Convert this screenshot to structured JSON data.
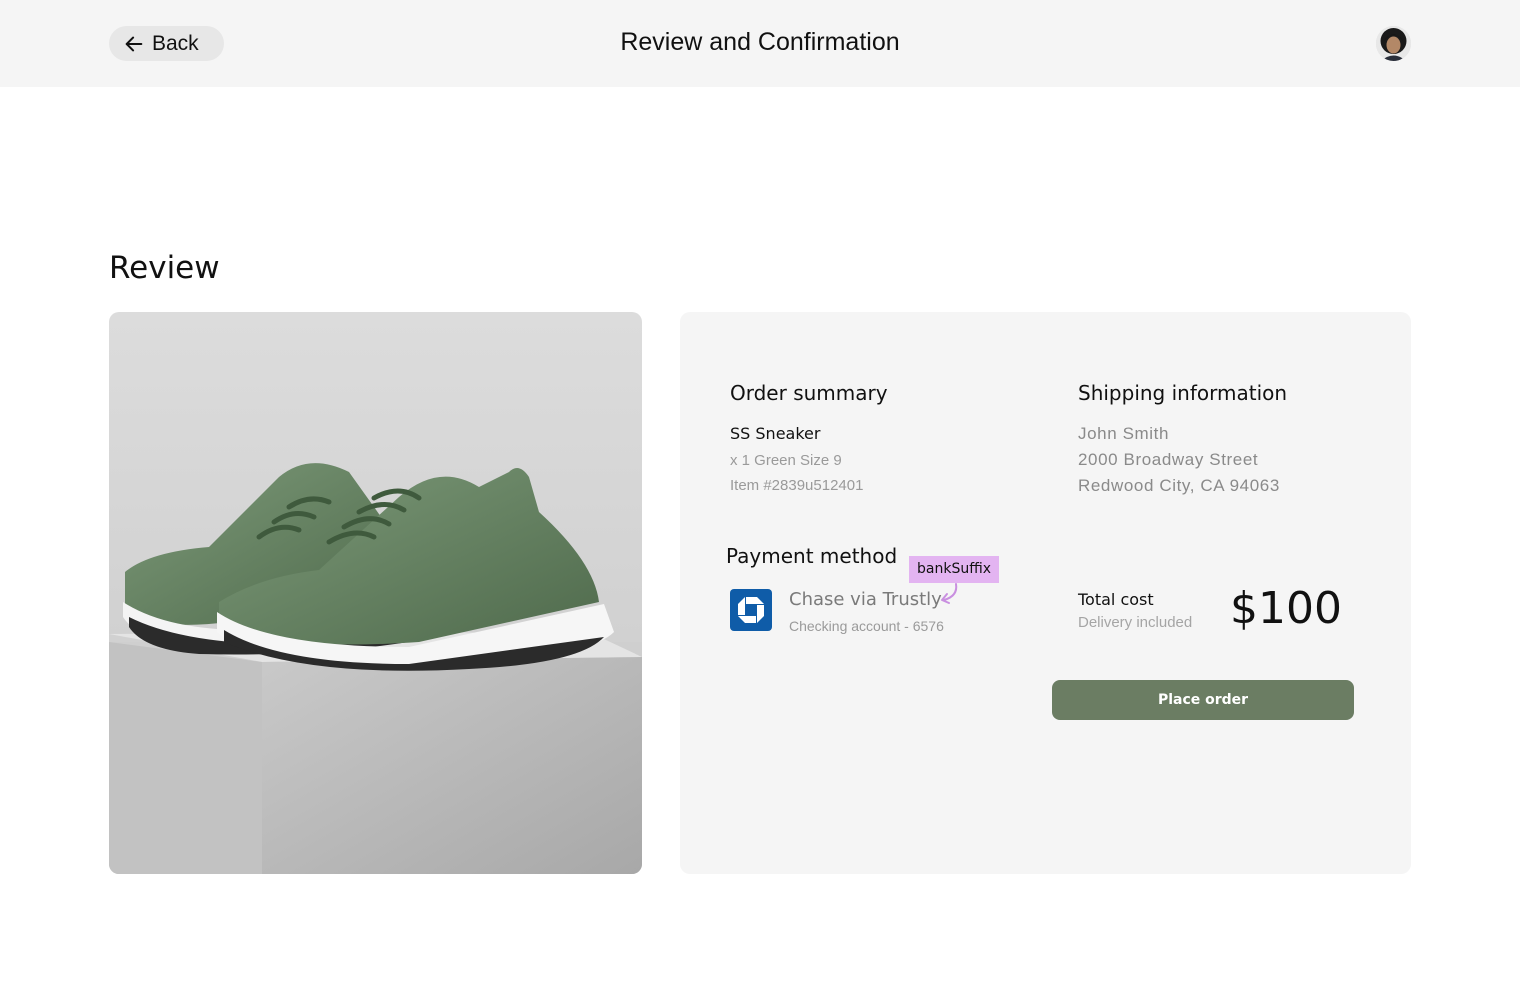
{
  "header": {
    "back_label": "Back",
    "title": "Review and Confirmation",
    "avatar_icon": "user-avatar-icon"
  },
  "section_title": "Review",
  "product_image": {
    "description_icon": "green-sneaker-photo"
  },
  "order_summary": {
    "heading": "Order summary",
    "item_name": "SS Sneaker",
    "item_variant": "x 1 Green Size 9",
    "item_number": "Item #2839u512401"
  },
  "shipping": {
    "heading": "Shipping information",
    "name": "John Smith",
    "street": "2000 Broadway Street",
    "city": "Redwood City, CA 94063"
  },
  "payment": {
    "heading": "Payment method",
    "bank_icon": "chase-bank-logo-icon",
    "method": "Chase via Trustly",
    "account": "Checking account - 6576",
    "annotation": "bankSuffix"
  },
  "total": {
    "label": "Total cost",
    "sub": "Delivery included",
    "price": "$100"
  },
  "actions": {
    "place_order": "Place order"
  },
  "colors": {
    "header_bg": "#f5f5f5",
    "button_bg": "#6b7d63",
    "tag_bg": "#e3b4f1",
    "bank_blue": "#0f5ca8"
  }
}
